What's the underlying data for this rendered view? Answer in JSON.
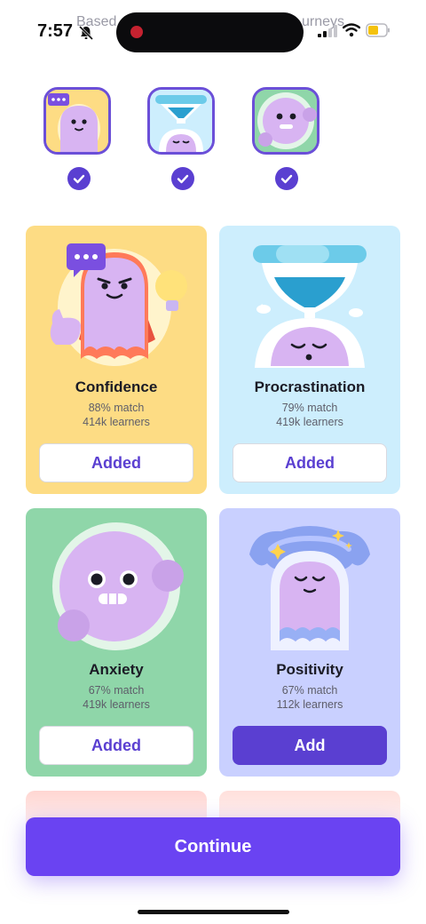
{
  "status_bar": {
    "time": "7:57",
    "bg_left": "Based",
    "bg_right": "urneys"
  },
  "colors": {
    "accent": "#5a3fd1",
    "continue": "#6a43f2",
    "confidence_bg": "#fddc84",
    "procrastination_bg": "#cdeefd",
    "anxiety_bg": "#8fd6a9",
    "positivity_bg": "#c9d0ff"
  },
  "cards": [
    {
      "title": "Confidence",
      "match": "88% match",
      "learners": "414k learners",
      "button": "Added"
    },
    {
      "title": "Procrastination",
      "match": "79% match",
      "learners": "419k learners",
      "button": "Added"
    },
    {
      "title": "Anxiety",
      "match": "67% match",
      "learners": "419k learners",
      "button": "Added"
    },
    {
      "title": "Positivity",
      "match": "67% match",
      "learners": "112k learners",
      "button": "Add"
    }
  ],
  "continue_label": "Continue",
  "icons": [
    "bell-slash-icon",
    "signal-icon",
    "wifi-icon",
    "battery-icon",
    "check-icon"
  ]
}
